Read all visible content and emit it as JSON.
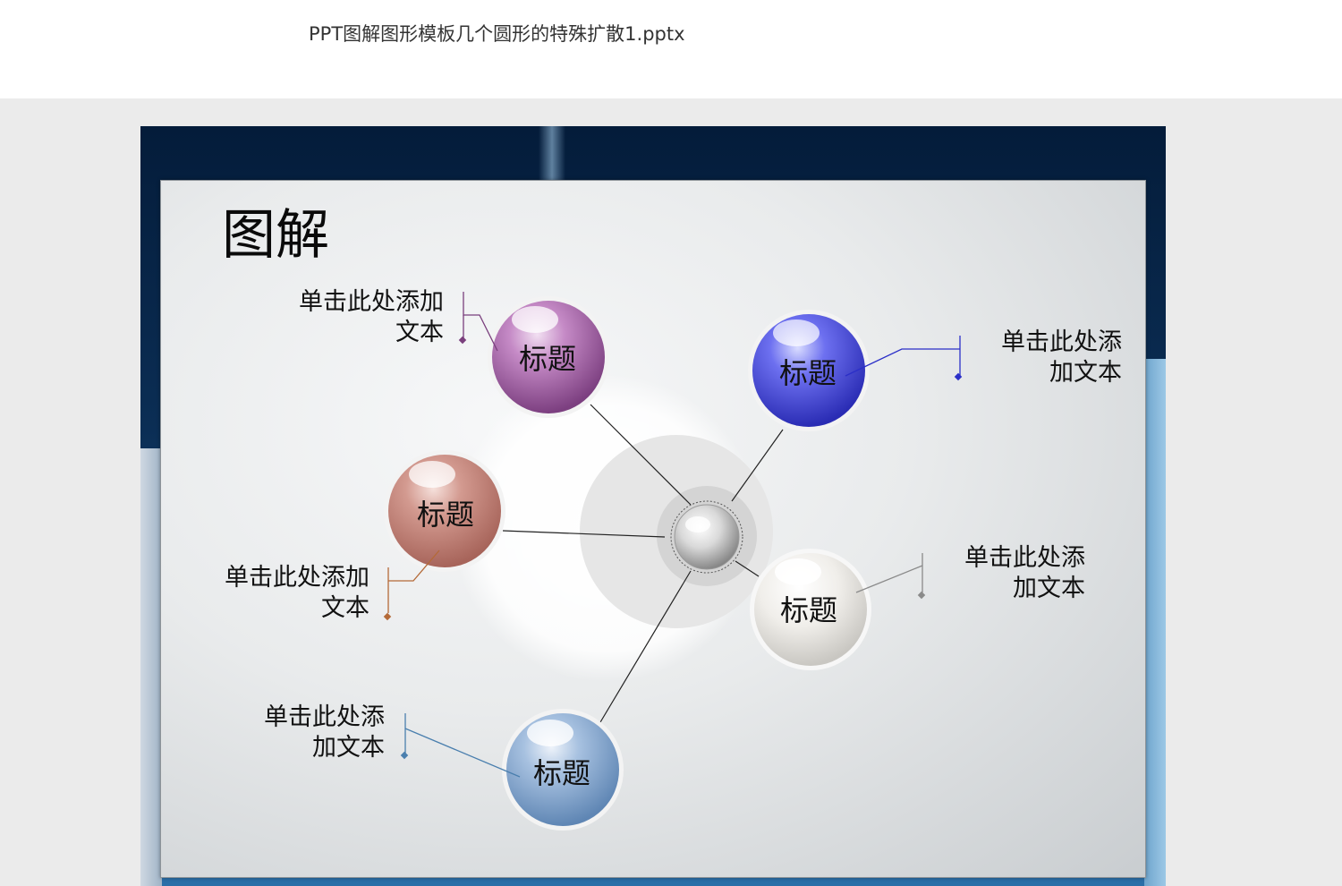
{
  "document": {
    "title": "PPT图解图形模板几个圆形的特殊扩散1.pptx"
  },
  "slide": {
    "title": "图解",
    "bubbles": [
      {
        "label": "标题",
        "color": "#a863a8"
      },
      {
        "label": "标题",
        "color": "#5558e0"
      },
      {
        "label": "标题",
        "color": "#cf8a80"
      },
      {
        "label": "标题",
        "color": "#e8e6e2"
      },
      {
        "label": "标题",
        "color": "#8fb1d6"
      }
    ],
    "callouts": [
      {
        "line1": "单击此处添加",
        "line2": "文本",
        "color": "#7a3f7d"
      },
      {
        "line1": "单击此处添",
        "line2": "加文本",
        "color": "#2b2fc8"
      },
      {
        "line1": "单击此处添加",
        "line2": "文本",
        "color": "#b46a38"
      },
      {
        "line1": "单击此处添",
        "line2": "加文本",
        "color": "#8a8a8a"
      },
      {
        "line1": "单击此处添",
        "line2": "加文本",
        "color": "#4a7fae"
      }
    ]
  }
}
